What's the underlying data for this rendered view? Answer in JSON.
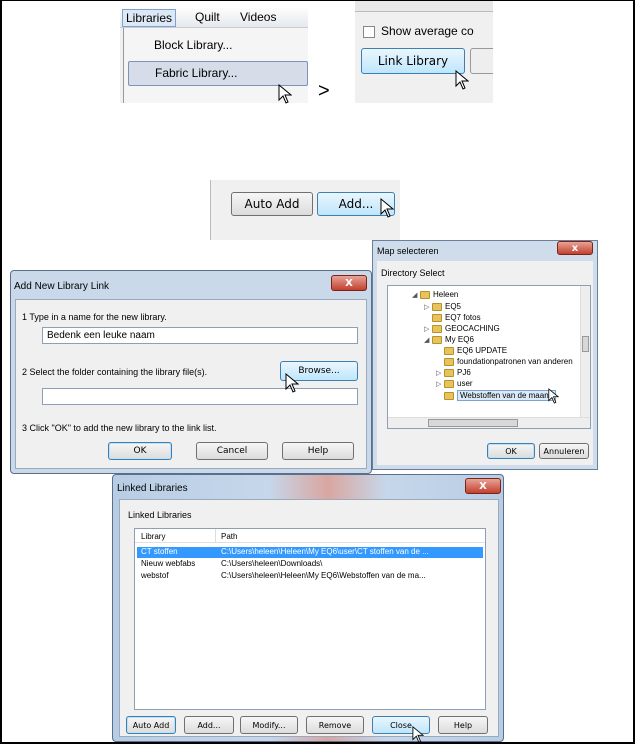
{
  "menu": {
    "bar_items": [
      "Libraries",
      "Quilt",
      "Videos"
    ],
    "items": [
      "Block Library...",
      "Fabric Library..."
    ]
  },
  "link_panel": {
    "checkbox_label": "Show average co",
    "link_button": "Link Library",
    "arrow": ">"
  },
  "add_panel": {
    "auto_add": "Auto Add",
    "add": "Add..."
  },
  "map_dialog": {
    "title": "Map selecteren",
    "subtitle": "Directory Select",
    "tree": [
      {
        "label": "Heleen",
        "level": 0,
        "expanded": true
      },
      {
        "label": "EQ5",
        "level": 1,
        "expanded": false
      },
      {
        "label": "EQ7 fotos",
        "level": 1,
        "expanded": null
      },
      {
        "label": "GEOCACHING",
        "level": 1,
        "expanded": false
      },
      {
        "label": "My EQ6",
        "level": 1,
        "expanded": true
      },
      {
        "label": "EQ6 UPDATE",
        "level": 2,
        "expanded": null
      },
      {
        "label": "foundationpatronen van anderen",
        "level": 2,
        "expanded": null
      },
      {
        "label": "PJ6",
        "level": 2,
        "expanded": false
      },
      {
        "label": "user",
        "level": 2,
        "expanded": false
      },
      {
        "label": "Webstoffen van de maand",
        "level": 2,
        "expanded": null,
        "selected": true
      }
    ],
    "ok": "OK",
    "cancel": "Annuleren"
  },
  "add_link_dialog": {
    "title": "Add New Library Link",
    "step1": "1   Type in a name for the new library.",
    "name_value": "Bedenk een leuke naam",
    "step2": "2   Select the folder containing the library file(s).",
    "browse": "Browse...",
    "folder_value": "",
    "step3": "3   Click \"OK\" to add the new library to the link list.",
    "ok": "OK",
    "cancel": "Cancel",
    "help": "Help",
    "close": "X"
  },
  "linked_dialog": {
    "title": "Linked Libraries",
    "group_label": "Linked Libraries",
    "columns": [
      "Library",
      "Path"
    ],
    "rows": [
      {
        "library": "CT stoffen",
        "path": "C:\\Users\\heleen\\Heleen\\My EQ6\\user\\CT stoffen van de ...",
        "selected": true
      },
      {
        "library": "Nieuw webfabs",
        "path": "C:\\Users\\heleen\\Downloads\\",
        "selected": false
      },
      {
        "library": "webstof",
        "path": "C:\\Users\\heleen\\Heleen\\My EQ6\\Webstoffen van de ma...",
        "selected": false
      }
    ],
    "buttons": [
      "Auto Add",
      "Add...",
      "Modify...",
      "Remove",
      "Close",
      "Help"
    ],
    "close": "X"
  }
}
